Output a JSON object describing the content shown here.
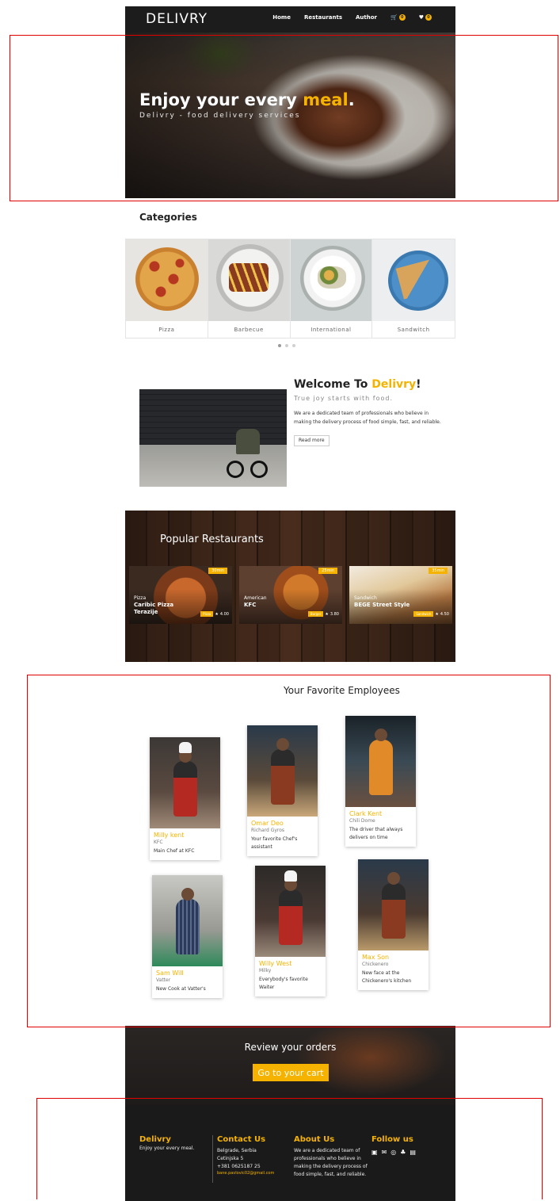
{
  "nav": {
    "brand": "DELIVRY",
    "links": [
      "Home",
      "Restaurants",
      "Author"
    ],
    "cart_count": "0",
    "fav_count": "0"
  },
  "hero": {
    "title_main": "Enjoy your every ",
    "title_accent": "meal",
    "title_end": ".",
    "subtitle": "Delivry - food delivery services"
  },
  "categories": {
    "title": "Categories",
    "items": [
      "Pizza",
      "Barbecue",
      "International",
      "Sandwitch"
    ]
  },
  "welcome": {
    "title_main": "Welcome To ",
    "title_accent": "Delivry",
    "title_end": "!",
    "subtitle": "True joy starts with food.",
    "text": "We are a dedicated team of professionals who believe in making the delivery process of food simple, fast, and reliable.",
    "button": "Read more"
  },
  "restaurants": {
    "title": "Popular Restaurants",
    "items": [
      {
        "time": "30min",
        "category": "Pizza",
        "name": "Caribic Pizza Terazije",
        "tag": "Pizza",
        "rating": "4.00"
      },
      {
        "time": "25min",
        "category": "American",
        "name": "KFC",
        "tag": "Burger",
        "rating": "3.80"
      },
      {
        "time": "35min",
        "category": "Sandwich",
        "name": "BEGE Street Style",
        "tag": "Sandwich",
        "rating": "4.50"
      }
    ]
  },
  "employees": {
    "title": "Your Favorite Employees",
    "items": [
      {
        "name": "Milly kent",
        "place": "KFC",
        "desc": "Main Chef at KFC"
      },
      {
        "name": "Omar Deo",
        "place": "Richard Gyros",
        "desc": "Your favorite Chef's assistant"
      },
      {
        "name": "Clark Kent",
        "place": "Chili Dome",
        "desc": "The driver that always delivers on time"
      },
      {
        "name": "Sam Will",
        "place": "Vatter",
        "desc": "New Cook at Vatter's"
      },
      {
        "name": "Willy West",
        "place": "Milky",
        "desc": "Everybody's favorite Waiter"
      },
      {
        "name": "Max Son",
        "place": "Chickenero",
        "desc": "New face at the Chickenero's kitchen"
      }
    ]
  },
  "review": {
    "title": "Review your orders",
    "button": "Go to your cart"
  },
  "footer": {
    "brand": "Delivry",
    "tagline": "Enjoy your every meal.",
    "contact_title": "Contact Us",
    "address1": "Belgrade, Serbia",
    "address2": "Cetinjska 5",
    "phone": "+381 0625187 25",
    "email": "bane.pavlovic02@gmail.com",
    "about_title": "About Us",
    "about_text": "We are a dedicated team of professionals who believe in making the delivery process of food simple, fast, and reliable.",
    "follow_title": "Follow us"
  },
  "colors": {
    "accent": "#f5b300",
    "nav_bg": "#1c1c1c",
    "footer_bg": "#1a1a1a"
  }
}
